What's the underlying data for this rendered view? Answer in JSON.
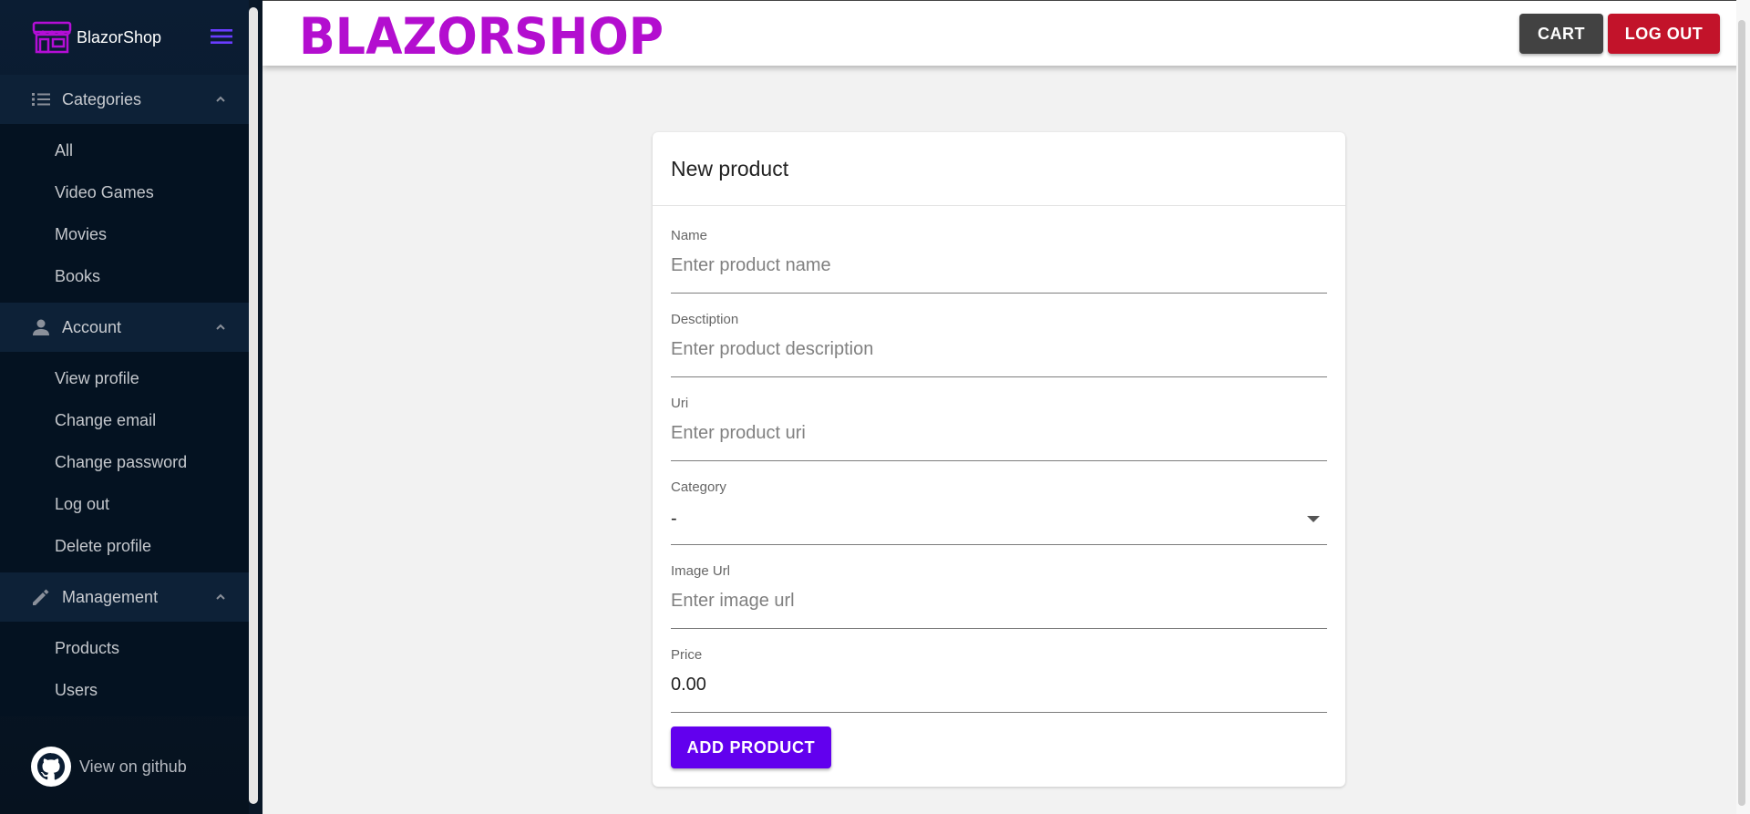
{
  "brand": {
    "name": "BlazorShop",
    "logo_text": "BLAZORSHOP",
    "logo_color": "#b30ecf"
  },
  "sidebar": {
    "sections": [
      {
        "label": "Categories",
        "icon": "list-icon",
        "items": [
          "All",
          "Video Games",
          "Movies",
          "Books"
        ]
      },
      {
        "label": "Account",
        "icon": "person-icon",
        "items": [
          "View profile",
          "Change email",
          "Change password",
          "Log out",
          "Delete profile"
        ]
      },
      {
        "label": "Management",
        "icon": "pencil-icon",
        "items": [
          "Products",
          "Users"
        ]
      }
    ],
    "github_label": "View on github"
  },
  "header": {
    "cart_label": "CART",
    "logout_label": "LOG OUT"
  },
  "form": {
    "title": "New product",
    "fields": [
      {
        "label": "Name",
        "placeholder": "Enter product name",
        "value": ""
      },
      {
        "label": "Desctiption",
        "placeholder": "Enter product description",
        "value": ""
      },
      {
        "label": "Uri",
        "placeholder": "Enter product uri",
        "value": ""
      },
      {
        "label": "Category",
        "value": "-"
      },
      {
        "label": "Image Url",
        "placeholder": "Enter image url",
        "value": ""
      },
      {
        "label": "Price",
        "placeholder": "",
        "value": "0.00"
      }
    ],
    "submit_label": "ADD PRODUCT"
  },
  "colors": {
    "accent": "#6200ee",
    "logout": "#c2132a",
    "cart": "#424242",
    "sidebar_bg": "#0b1d33"
  }
}
